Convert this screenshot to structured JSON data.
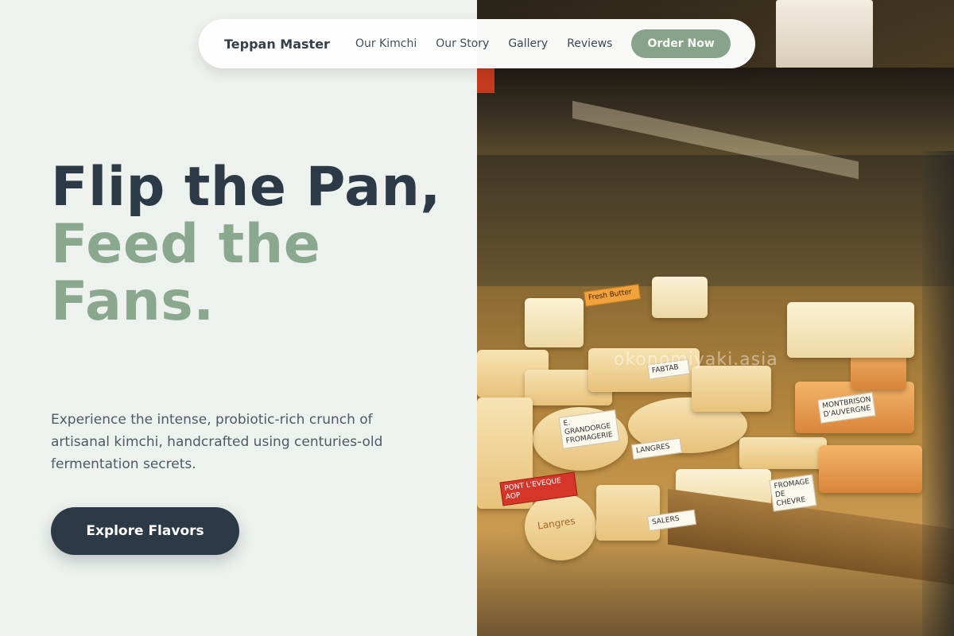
{
  "nav": {
    "brand": "Teppan Master",
    "links": [
      {
        "label": "Our Kimchi"
      },
      {
        "label": "Our Story"
      },
      {
        "label": "Gallery"
      },
      {
        "label": "Reviews"
      }
    ],
    "cta": "Order Now"
  },
  "hero": {
    "title_dark": "Flip the Pan,",
    "title_accent": "Feed the Fans.",
    "subtitle": "Experience the intense, probiotic-rich crunch of artisanal kimchi, handcrafted using centuries-old fermentation secrets.",
    "button": "Explore Flavors"
  },
  "photo": {
    "watermark": "okonomiyaki.asia",
    "labels": {
      "fresh": "Fresh Butter",
      "grandorge": "E. GRANDORGE FROMAGERIE",
      "langres": "LANGRES",
      "langres_box": "Langres",
      "fabtabbe": "FABTAB",
      "red_label": "PONT L'EVEQUE AOP",
      "tag_right": "MONTBRISON D'AUVERGNE",
      "tag_mid": "FROMAGE DE CHEVRE",
      "tag_bottom": "SALERS"
    }
  },
  "colors": {
    "background": "#eef2ee",
    "primary_dark": "#2c3a47",
    "accent_sage": "#8aa88e",
    "nav_bg": "#ffffff"
  }
}
